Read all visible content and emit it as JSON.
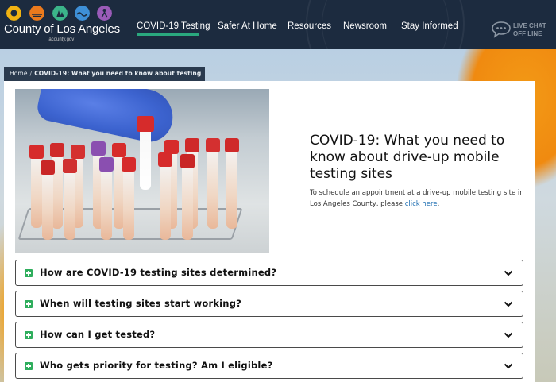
{
  "header": {
    "logo_title": "County of Los Angeles",
    "logo_subtitle": "lacounty.gov",
    "logo_icons": [
      "sun-icon",
      "sunset-icon",
      "trees-icon",
      "wave-icon",
      "person-icon"
    ],
    "nav": [
      {
        "label": "COVID-19 Testing",
        "active": true
      },
      {
        "label": "Safer At Home",
        "active": false
      },
      {
        "label": "Resources",
        "active": false
      },
      {
        "label": "Newsroom",
        "active": false
      },
      {
        "label": "Stay Informed",
        "active": false
      }
    ],
    "live_chat": {
      "line1": "LIVE CHAT",
      "line2": "OFF LINE"
    }
  },
  "breadcrumb": {
    "home": "Home",
    "separator": "/",
    "current": "COVID-19: What you need to know about testing"
  },
  "main": {
    "title": "COVID-19: What you need to know about drive-up mobile testing sites",
    "description_prefix": "To schedule an appointment at a drive-up mobile testing site in Los Angeles County, please ",
    "description_link": "click here",
    "description_suffix": "."
  },
  "faq": [
    {
      "question": "How are COVID-19 testing sites determined?"
    },
    {
      "question": "When will testing sites start working?"
    },
    {
      "question": "How can I get tested?"
    },
    {
      "question": "Who gets priority for testing? Am I eligible?"
    }
  ],
  "colors": {
    "header_bg": "#1c2b3f",
    "nav_active": "#2aa87e",
    "plus_icon": "#2fae5d",
    "link": "#1f6fb2"
  }
}
